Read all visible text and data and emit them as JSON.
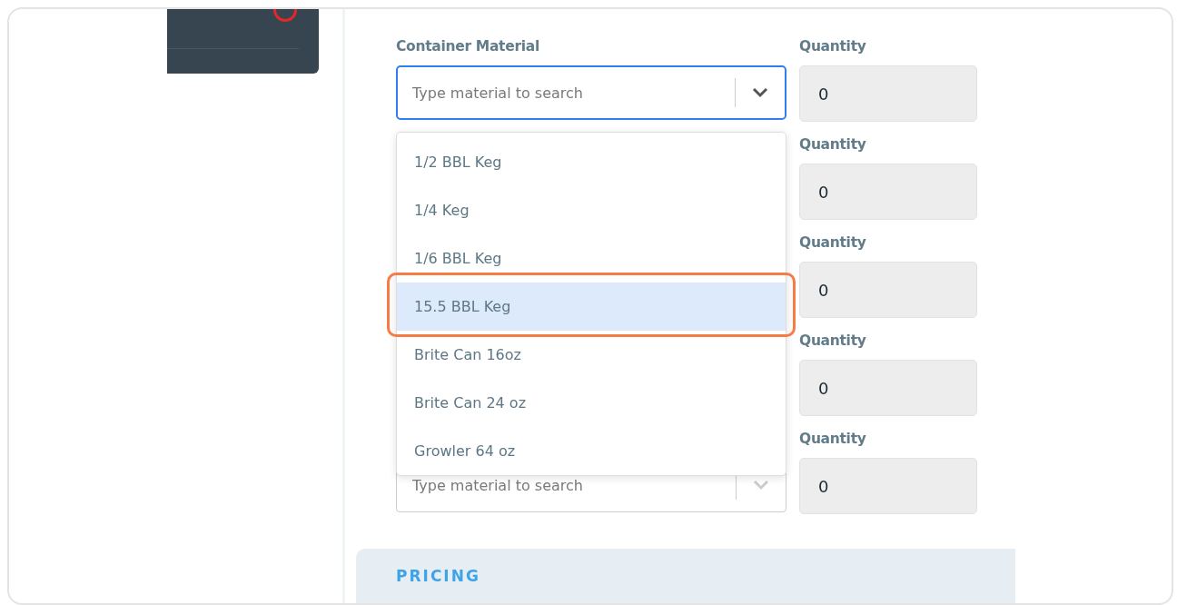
{
  "material_label": "Container Material",
  "rows": [
    {
      "placeholder": "Type material to search",
      "focused": true,
      "quantity_label": "Quantity",
      "quantity": "0"
    },
    {
      "quantity_label": "Quantity",
      "quantity": "0"
    },
    {
      "quantity_label": "Quantity",
      "quantity": "0"
    },
    {
      "quantity_label": "Quantity",
      "quantity": "0"
    },
    {
      "placeholder": "Type material to search",
      "focused": false,
      "quantity_label": "Quantity",
      "quantity": "0"
    }
  ],
  "dropdown_options": [
    {
      "label": "1/2 BBL Keg",
      "selected": false,
      "annotated": false
    },
    {
      "label": "1/4 Keg",
      "selected": false,
      "annotated": false
    },
    {
      "label": "1/6 BBL Keg",
      "selected": false,
      "annotated": false
    },
    {
      "label": "15.5 BBL Keg",
      "selected": true,
      "annotated": true
    },
    {
      "label": "Brite Can 16oz",
      "selected": false,
      "annotated": false
    },
    {
      "label": "Brite Can 24 oz",
      "selected": false,
      "annotated": false
    },
    {
      "label": "Growler 64 oz",
      "selected": false,
      "annotated": false
    }
  ],
  "pricing_title": "PRICING"
}
